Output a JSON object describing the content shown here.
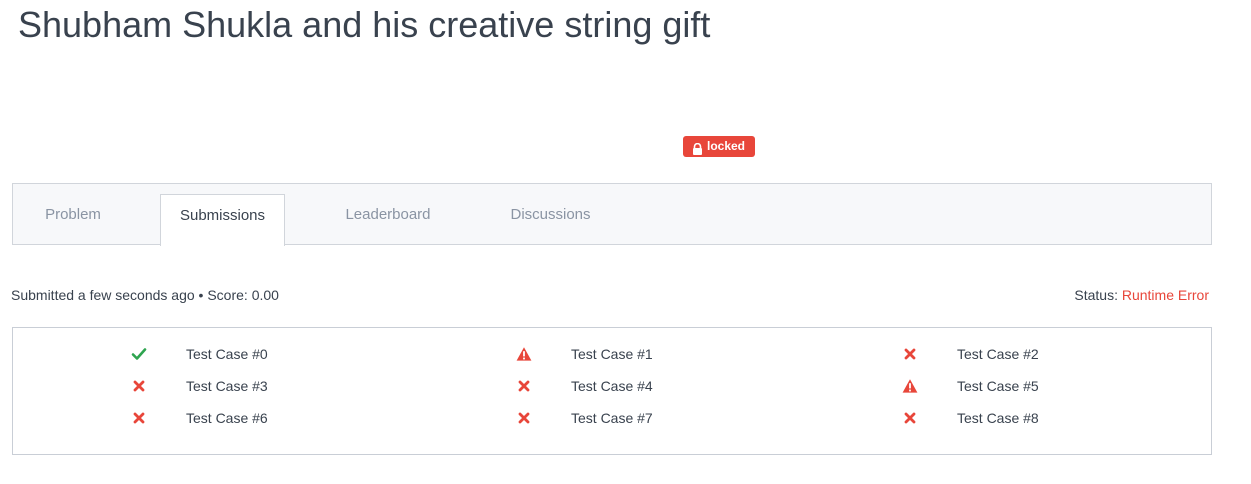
{
  "challenge": {
    "title": "Shubham Shukla and his creative string gift",
    "badge_label": "locked"
  },
  "tabs": [
    {
      "label": "Problem"
    },
    {
      "label": "Submissions"
    },
    {
      "label": "Leaderboard"
    },
    {
      "label": "Discussions"
    }
  ],
  "submission": {
    "summary": "Submitted a few seconds ago • Score: 0.00",
    "status_label": "Status:",
    "status_value": "Runtime Error"
  },
  "test_cases": [
    {
      "label": "Test Case #0",
      "result": "check-icon"
    },
    {
      "label": "Test Case #1",
      "result": "warning-icon"
    },
    {
      "label": "Test Case #2",
      "result": "cross-icon"
    },
    {
      "label": "Test Case #3",
      "result": "cross-icon"
    },
    {
      "label": "Test Case #4",
      "result": "cross-icon"
    },
    {
      "label": "Test Case #5",
      "result": "warning-icon"
    },
    {
      "label": "Test Case #6",
      "result": "cross-icon"
    },
    {
      "label": "Test Case #7",
      "result": "cross-icon"
    },
    {
      "label": "Test Case #8",
      "result": "cross-icon"
    }
  ],
  "colors": {
    "pass": "#2ea44f",
    "fail": "#e8463a",
    "badge": "#e8463a"
  }
}
